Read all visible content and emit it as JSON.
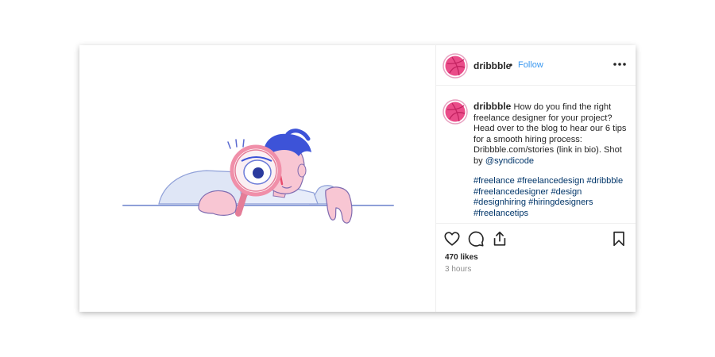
{
  "post": {
    "username": "dribbble",
    "dot": "•",
    "follow_label": "Follow",
    "caption_text": "How do you find the right freelance designer for your project? Head over to the blog to hear our 6 tips for a smooth hiring process: Dribbble.com/stories (link in bio). Shot by ",
    "mention": "@syndicode",
    "hashtags": [
      "#freelance",
      "#freelancedesign",
      "#dribbble",
      "#freelancedesigner",
      "#design",
      "#designhiring",
      "#hiringdesigners",
      "#freelancetips"
    ],
    "likes": "470 likes",
    "time": "3 hours"
  },
  "icons": {
    "more": "more-options-icon",
    "like": "heart-icon",
    "comment": "comment-icon",
    "share": "share-icon",
    "save": "bookmark-icon"
  },
  "colors": {
    "link_blue": "#3897f0",
    "hashtag": "#003569",
    "avatar_pink": "#ea4c89",
    "muted": "#8e8e8e"
  }
}
